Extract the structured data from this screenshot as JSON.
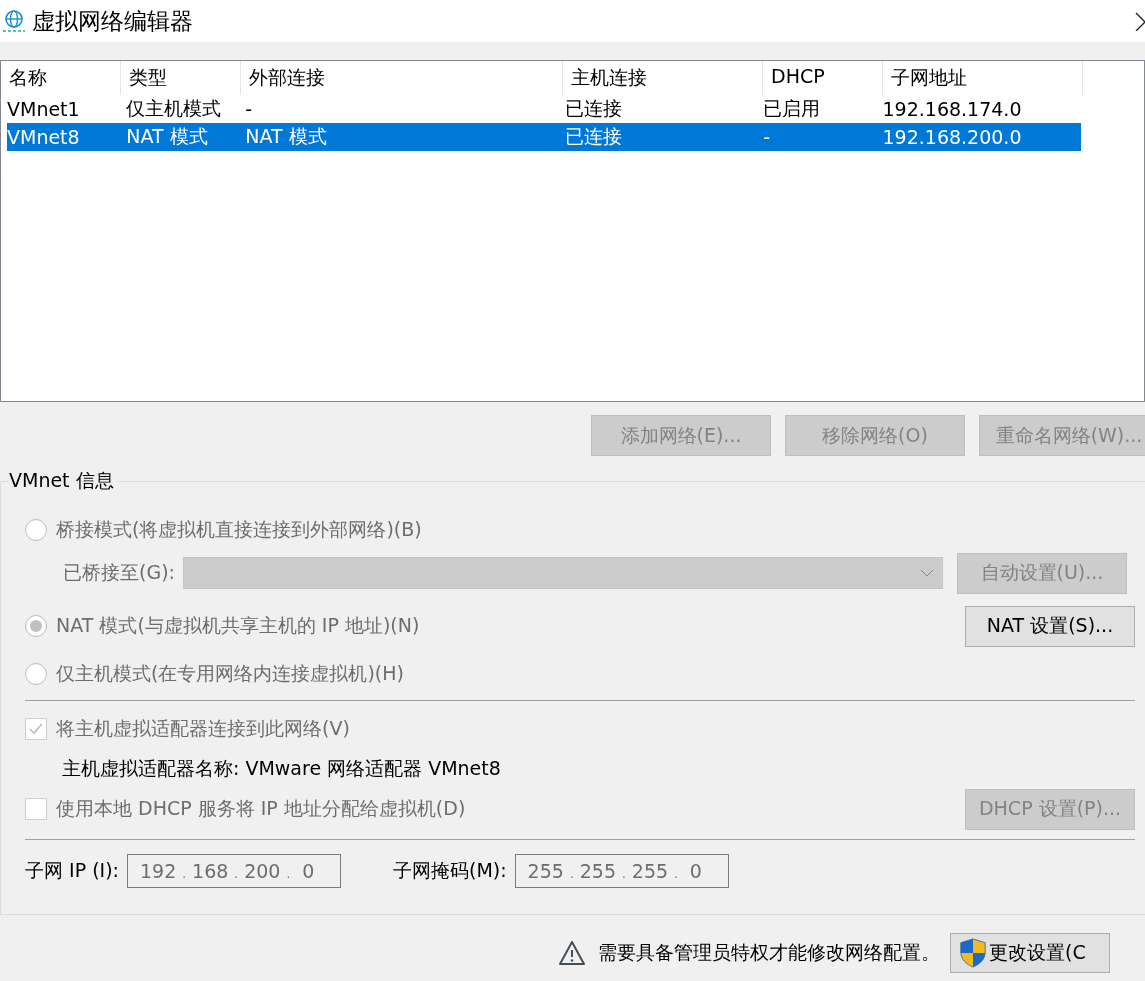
{
  "window": {
    "title": "虚拟网络编辑器"
  },
  "table": {
    "columns": [
      "名称",
      "类型",
      "外部连接",
      "主机连接",
      "DHCP",
      "子网地址"
    ],
    "rows": [
      {
        "cells": [
          "VMnet1",
          "仅主机模式",
          "-",
          "已连接",
          "已启用",
          "192.168.174.0"
        ],
        "selected": false
      },
      {
        "cells": [
          "VMnet8",
          "NAT 模式",
          "NAT 模式",
          "已连接",
          "-",
          "192.168.200.0"
        ],
        "selected": true
      }
    ]
  },
  "network_buttons": [
    {
      "label": "添加网络(E)...",
      "disabled": true
    },
    {
      "label": "移除网络(O)",
      "disabled": true
    },
    {
      "label": "重命名网络(W)...",
      "disabled": true
    }
  ],
  "vmnet_info": {
    "title": "VMnet 信息",
    "modes": [
      {
        "label": "桥接模式(将虚拟机直接连接到外部网络)(B)",
        "selected": false,
        "disabled": true
      },
      {
        "label": "NAT 模式(与虚拟机共享主机的 IP 地址)(N)",
        "selected": true,
        "disabled": true
      },
      {
        "label": "仅主机模式(在专用网络内连接虚拟机)(H)",
        "selected": false,
        "disabled": true
      }
    ],
    "bridged_to": {
      "label": "已桥接至(G):",
      "disabled": true
    },
    "auto_button": {
      "label": "自动设置(U)...",
      "disabled": true
    },
    "nat_button": {
      "label": "NAT 设置(S)...",
      "disabled": false
    },
    "connect_adapter": {
      "label": "将主机虚拟适配器连接到此网络(V)",
      "checked": true,
      "disabled": true
    },
    "adapter_name": "主机虚拟适配器名称: VMware 网络适配器 VMnet8",
    "use_dhcp": {
      "label": "使用本地 DHCP 服务将 IP 地址分配给虚拟机(D)",
      "checked": false,
      "disabled": true
    },
    "dhcp_button": {
      "label": "DHCP 设置(P)...",
      "disabled": true
    },
    "subnet_ip": {
      "label": "子网 IP (I):",
      "octets": [
        "192",
        "168",
        "200",
        "0"
      ],
      "separator": "."
    },
    "subnet_mask": {
      "label": "子网掩码(M):",
      "octets": [
        "255",
        "255",
        "255",
        "0"
      ],
      "separator": "."
    }
  },
  "footer": {
    "message": "需要具备管理员特权才能修改网络配置。",
    "button": "更改设置(C"
  }
}
